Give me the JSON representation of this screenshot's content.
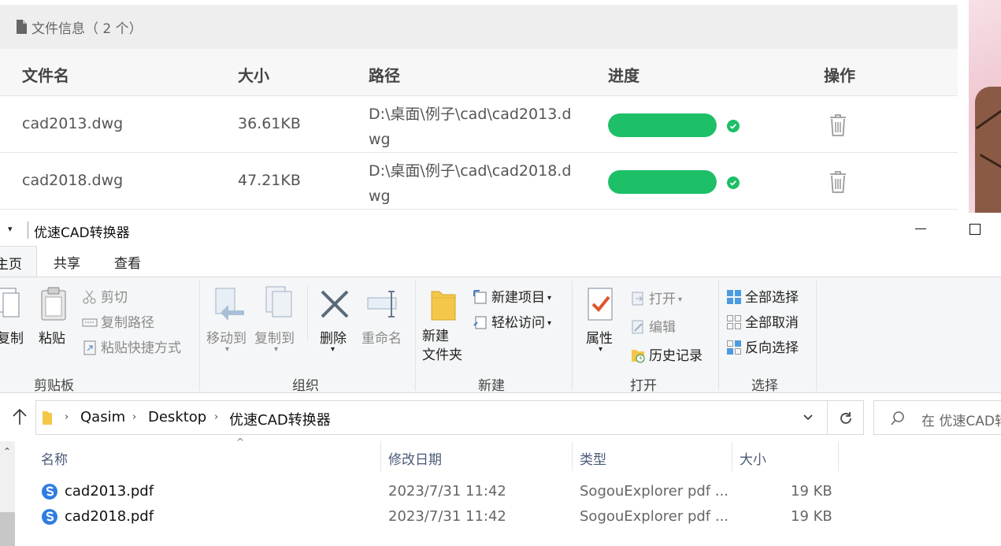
{
  "converter": {
    "file_info_title": "文件信息（ 2 个）",
    "columns": {
      "name": "文件名",
      "size": "大小",
      "path": "路径",
      "progress": "进度",
      "action": "操作"
    },
    "files": [
      {
        "name": "cad2013.dwg",
        "size": "36.61KB",
        "path": "D:\\桌面\\例子\\cad\\cad2013.dwg",
        "progress": 1.0
      },
      {
        "name": "cad2018.dwg",
        "size": "47.21KB",
        "path": "D:\\桌面\\例子\\cad\\cad2018.dwg",
        "progress": 1.0
      }
    ],
    "colors": {
      "progress": "#1dbf67",
      "done": "#1dbf67",
      "trash": "#9a9a9a"
    },
    "icons": {
      "header": "document-icon",
      "done": "check-circle-icon",
      "delete": "trash-icon"
    }
  },
  "explorer": {
    "window_title": "优速CAD转换器",
    "tabs": {
      "home": "主页",
      "share": "共享",
      "view": "查看"
    },
    "ribbon": {
      "clipboard": {
        "label": "剪贴板",
        "copy": "复制",
        "paste": "粘贴",
        "cut": "剪切",
        "copy_path": "复制路径",
        "paste_shortcut": "粘贴快捷方式"
      },
      "organize": {
        "label": "组织",
        "move_to": "移动到",
        "copy_to": "复制到",
        "delete": "删除",
        "rename": "重命名"
      },
      "new": {
        "label": "新建",
        "new_folder": "新建\n文件夹",
        "new_item": "新建项目",
        "easy_access": "轻松访问"
      },
      "open": {
        "label": "打开",
        "properties": "属性",
        "open": "打开",
        "edit": "编辑",
        "history": "历史记录"
      },
      "select": {
        "label": "选择",
        "select_all": "全部选择",
        "select_none": "全部取消",
        "invert": "反向选择"
      }
    },
    "address": {
      "segments": [
        "Qasim",
        "Desktop",
        "优速CAD转换器"
      ],
      "search_placeholder": "在 优速CAD转"
    },
    "list": {
      "columns": {
        "name": "名称",
        "date": "修改日期",
        "type": "类型",
        "size": "大小"
      },
      "rows": [
        {
          "name": "cad2013.pdf",
          "date": "2023/7/31 11:42",
          "type": "SogouExplorer pdf ...",
          "size": "19 KB"
        },
        {
          "name": "cad2018.pdf",
          "date": "2023/7/31 11:42",
          "type": "SogouExplorer pdf ...",
          "size": "19 KB"
        }
      ]
    }
  }
}
